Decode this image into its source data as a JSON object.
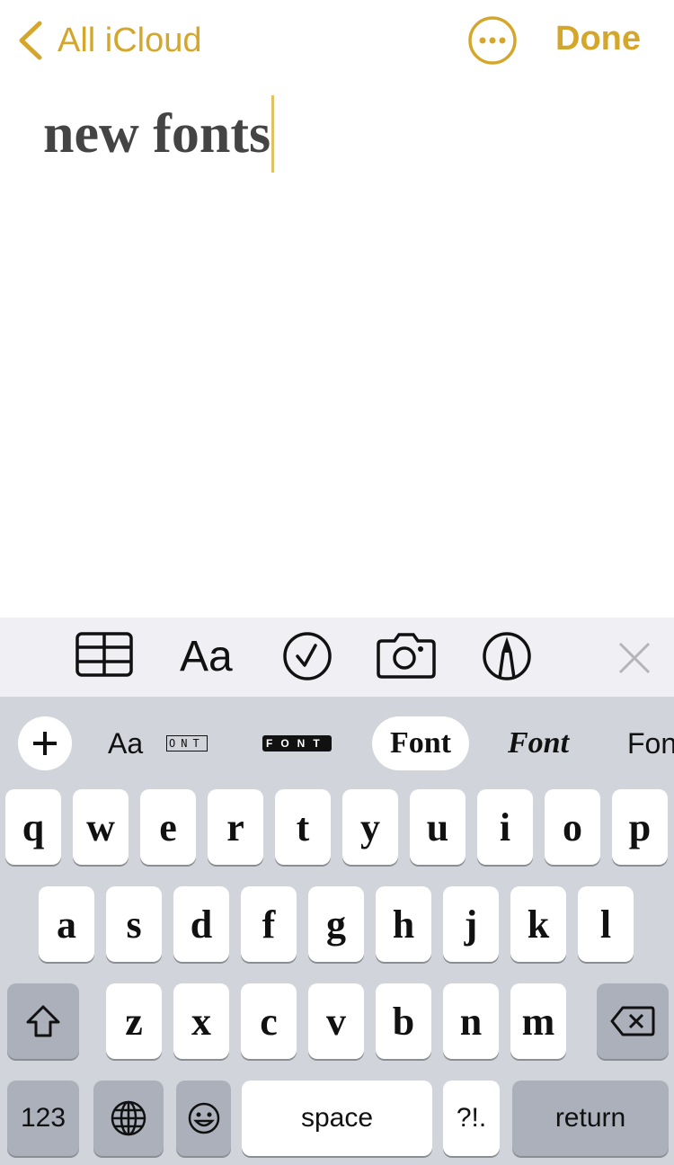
{
  "nav": {
    "back_label": "All iCloud",
    "done_label": "Done",
    "accent": "#d4a72c"
  },
  "note": {
    "text": "new fonts"
  },
  "toolbar": {
    "icons": [
      "table-icon",
      "text-format-icon",
      "checklist-icon",
      "camera-icon",
      "markup-icon",
      "close-icon"
    ],
    "format_label": "Aa"
  },
  "font_bar": {
    "items": [
      {
        "label": "Aa"
      },
      {
        "label": "ONT"
      },
      {
        "label": "FONT"
      },
      {
        "label": "Font",
        "selected": true
      },
      {
        "label": "Font"
      },
      {
        "label": "Fon"
      }
    ]
  },
  "keyboard": {
    "row1": [
      "q",
      "w",
      "e",
      "r",
      "t",
      "y",
      "u",
      "i",
      "o",
      "p"
    ],
    "row2": [
      "a",
      "s",
      "d",
      "f",
      "g",
      "h",
      "j",
      "k",
      "l"
    ],
    "row3": [
      "z",
      "x",
      "c",
      "v",
      "b",
      "n",
      "m"
    ],
    "numbers_label": "123",
    "space_label": "space",
    "punct_label": "?!.",
    "return_label": "return"
  }
}
